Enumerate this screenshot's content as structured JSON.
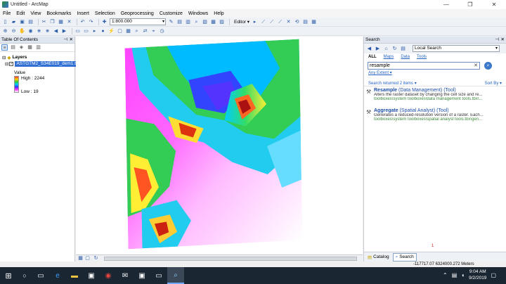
{
  "window": {
    "title": "Untitled - ArcMap",
    "min": "—",
    "max": "❐",
    "close": "✕"
  },
  "menu": [
    "File",
    "Edit",
    "View",
    "Bookmarks",
    "Insert",
    "Selection",
    "Geoprocessing",
    "Customize",
    "Windows",
    "Help"
  ],
  "toolbar": {
    "scale": "1:800.000",
    "editor_label": "Editor ▾"
  },
  "toc": {
    "title": "Table Of Contents",
    "group": "Layers",
    "layer_name": "ASTGTM2_S34E019_dem1.tif",
    "legend_value": "Value",
    "legend_high": "High : 2244",
    "legend_low": "Low : 19"
  },
  "search": {
    "title": "Search",
    "scope": "Local Search",
    "filters": [
      "ALL",
      "Maps",
      "Data",
      "Tools"
    ],
    "query": "resample",
    "extent": "Any Extent ▾",
    "returned": "Search returned 2 items ▾",
    "sort": "Sort By ▾",
    "results": [
      {
        "name": "Resample",
        "category": " (Data Management) (Tool)",
        "desc": "Alters the raster dataset by changing the cell size and re...",
        "path": "toolboxes\\system toolboxes\\data management tools.tbx\\..."
      },
      {
        "name": "Aggregate",
        "category": " (Spatial Analyst) (Tool)",
        "desc": "Generates a reduced-resolution version of a raster. Each...",
        "path": "toolboxes\\system toolboxes\\spatial analyst tools.tbx\\gen..."
      }
    ],
    "page": "1",
    "tab_catalog": "Catalog",
    "tab_search": "Search"
  },
  "status": {
    "coords": "-117717.07  6324000.272 Meters"
  },
  "taskbar": {
    "time": "9:04 AM",
    "date": "9/2/2019"
  },
  "colors": {
    "accent": "#3370d4",
    "taskbar": "#1b2633"
  }
}
